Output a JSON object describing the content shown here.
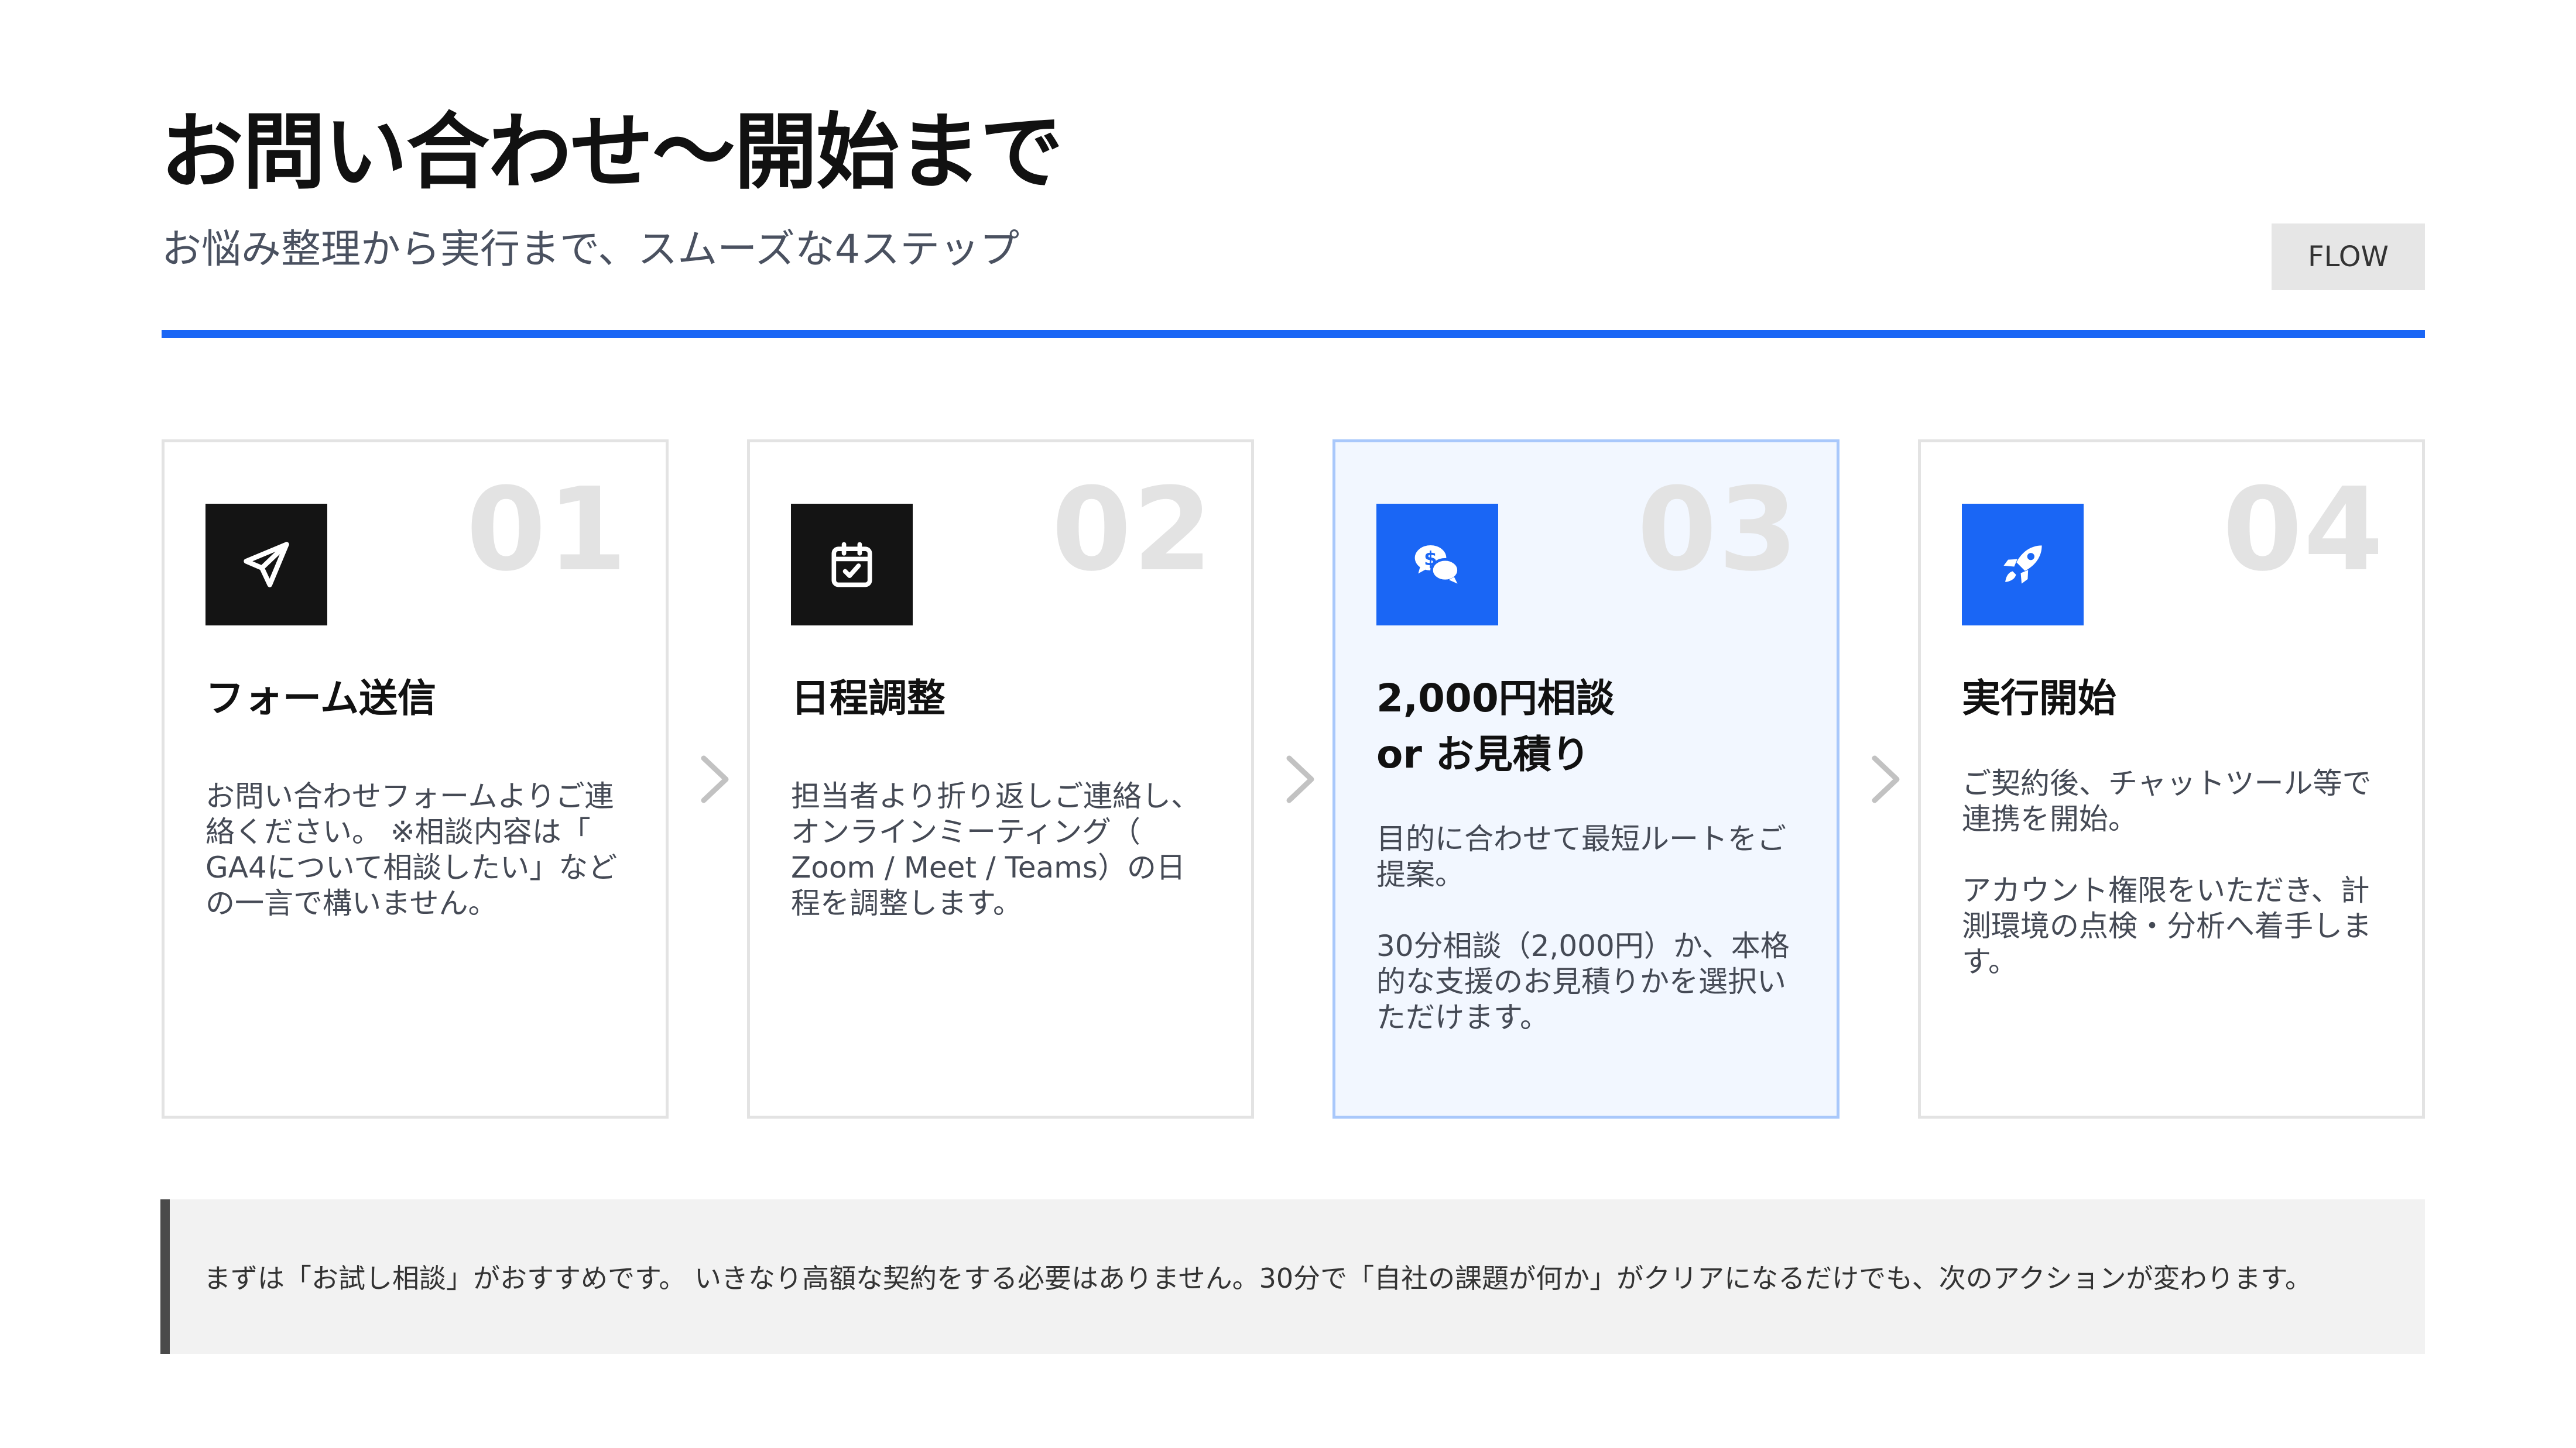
{
  "header": {
    "title": "お問い合わせ〜開始まで",
    "subtitle": "お悩み整理から実行まで、スムーズな4ステップ",
    "badge": "FLOW",
    "accent_color": "#1a66f5"
  },
  "steps": [
    {
      "number": "01",
      "icon": "paper-plane-icon",
      "title": "フォーム送信",
      "description": "お問い合わせフォームよりご連\n絡ください。 ※相談内容は「\nGA4について相談したい」など\nの一言で構いません。",
      "highlight": false
    },
    {
      "number": "02",
      "icon": "calendar-check-icon",
      "title": "日程調整",
      "description": "担当者より折り返しご連絡し、\nオンラインミーティング（\nZoom / Meet / Teams）の日\n程を調整します。",
      "highlight": false
    },
    {
      "number": "03",
      "icon": "consultation-dollar-icon",
      "title": "2,000円相談\nor お見積り",
      "description": "目的に合わせて最短ルートをご\n提案。\n\n30分相談（2,000円）か、本格\n的な支援のお見積りかを選択い\nただけます。",
      "highlight": true
    },
    {
      "number": "04",
      "icon": "rocket-icon",
      "title": "実行開始",
      "description": "ご契約後、チャットツール等で\n連携を開始。\n\nアカウント権限をいただき、計\n測環境の点検・分析へ着手しま\nす。",
      "highlight": false
    }
  ],
  "note": {
    "text": "まずは「お試し相談」がおすすめです。 いきなり高額な契約をする必要はありません。30分で「自社の課題が何か」がクリアになるだけでも、次のアクションが変わります。"
  }
}
